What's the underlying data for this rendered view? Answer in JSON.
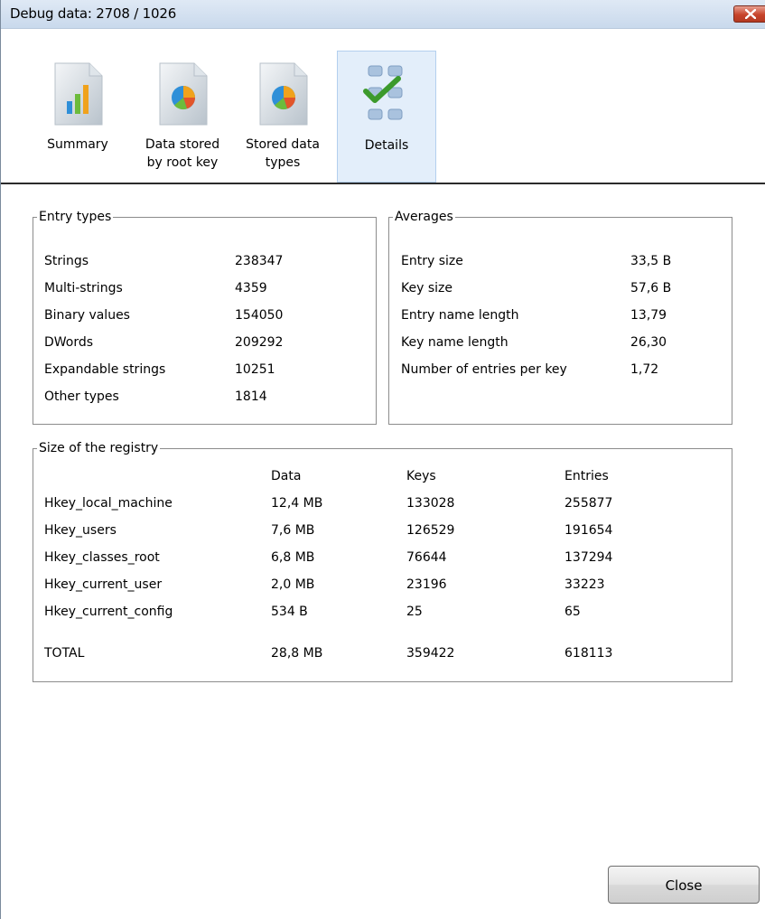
{
  "window": {
    "title": "Debug data: 2708 / 1026"
  },
  "toolbar": {
    "tabs": [
      {
        "label": "Summary",
        "icon": "bar-chart-document-icon"
      },
      {
        "label": "Data stored\nby root key",
        "icon": "pie-chart-document-icon"
      },
      {
        "label": "Stored data\ntypes",
        "icon": "pie-chart-document-icon"
      },
      {
        "label": "Details",
        "icon": "checklist-icon",
        "active": true
      }
    ]
  },
  "entry_types": {
    "title": "Entry types",
    "rows": [
      {
        "label": "Strings",
        "value": "238347"
      },
      {
        "label": "Multi-strings",
        "value": "4359"
      },
      {
        "label": "Binary values",
        "value": "154050"
      },
      {
        "label": "DWords",
        "value": "209292"
      },
      {
        "label": "Expandable strings",
        "value": "10251"
      },
      {
        "label": "Other types",
        "value": "1814"
      }
    ]
  },
  "averages": {
    "title": "Averages",
    "rows": [
      {
        "label": "Entry size",
        "value": "33,5 B"
      },
      {
        "label": "Key size",
        "value": "57,6 B"
      },
      {
        "label": "Entry name length",
        "value": "13,79"
      },
      {
        "label": "Key name length",
        "value": "26,30"
      },
      {
        "label": "Number of entries per key",
        "value": "1,72"
      }
    ]
  },
  "registry_size": {
    "title": "Size of the registry",
    "headers": [
      "Data",
      "Keys",
      "Entries"
    ],
    "rows": [
      {
        "name": "Hkey_local_machine",
        "data": "12,4 MB",
        "keys": "133028",
        "entries": "255877"
      },
      {
        "name": "Hkey_users",
        "data": "7,6 MB",
        "keys": "126529",
        "entries": "191654"
      },
      {
        "name": "Hkey_classes_root",
        "data": "6,8 MB",
        "keys": "76644",
        "entries": "137294"
      },
      {
        "name": "Hkey_current_user",
        "data": "2,0 MB",
        "keys": "23196",
        "entries": "33223"
      },
      {
        "name": "Hkey_current_config",
        "data": "534 B",
        "keys": "25",
        "entries": "65"
      }
    ],
    "total": {
      "name": "TOTAL",
      "data": "28,8 MB",
      "keys": "359422",
      "entries": "618113"
    }
  },
  "buttons": {
    "close_label": "Close"
  },
  "colors": {
    "titlebar": "#c9d9ec",
    "active_tab": "#e3eefa",
    "close_x": "#c7432a"
  }
}
